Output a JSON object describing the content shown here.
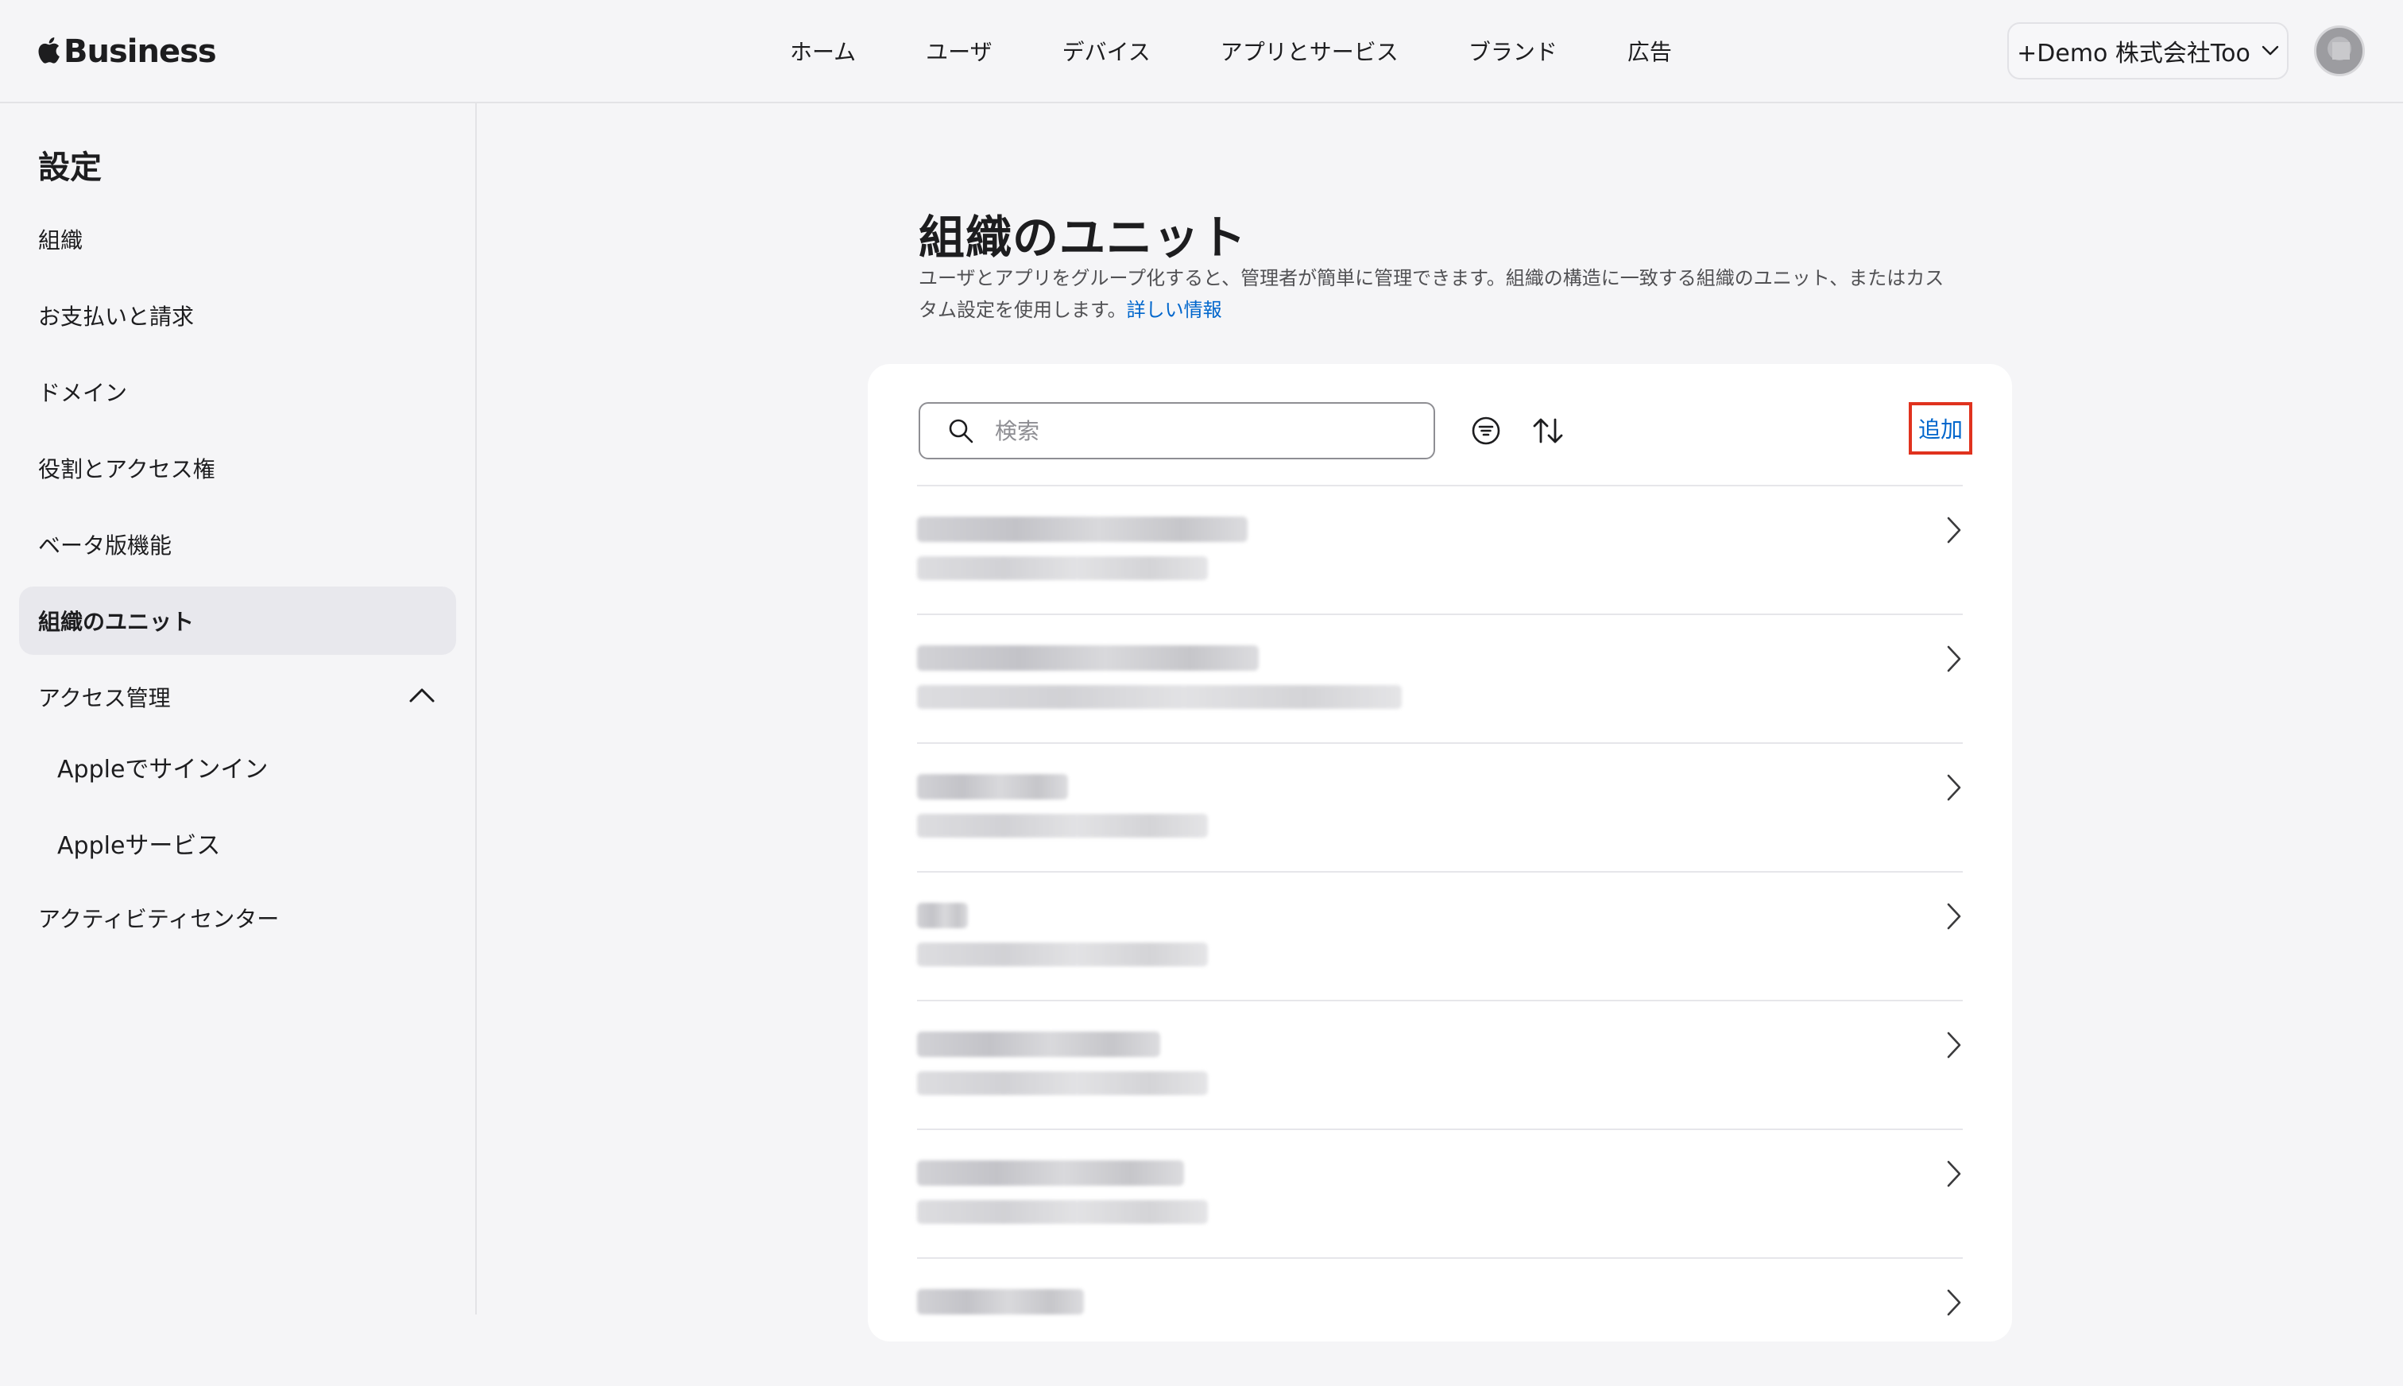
{
  "header": {
    "brand": "Business",
    "nav": [
      "ホーム",
      "ユーザ",
      "デバイス",
      "アプリとサービス",
      "ブランド",
      "広告"
    ],
    "org_switcher": "+Demo 株式会社Too"
  },
  "sidebar": {
    "title": "設定",
    "items": [
      {
        "label": "組織",
        "active": false
      },
      {
        "label": "お支払いと請求",
        "active": false
      },
      {
        "label": "ドメイン",
        "active": false
      },
      {
        "label": "役割とアクセス権",
        "active": false
      },
      {
        "label": "ベータ版機能",
        "active": false
      },
      {
        "label": "組織のユニット",
        "active": true
      },
      {
        "label": "アクセス管理",
        "expanded": true
      },
      {
        "label": "Appleでサインイン",
        "sub": true
      },
      {
        "label": "Appleサービス",
        "sub": true
      },
      {
        "label": "アクティビティセンター",
        "active": false
      }
    ]
  },
  "main": {
    "title": "組織のユニット",
    "description": "ユーザとアプリをグループ化すると、管理者が簡単に管理できます。組織の構造に一致する組織のユニット、またはカスタム設定を使用します。",
    "learn_more": "詳しい情報",
    "search_placeholder": "検索",
    "add_label": "追加",
    "highlight_color": "#e0321e",
    "link_color": "#0066cc",
    "rows_note": "blurred",
    "row_count": 7
  }
}
